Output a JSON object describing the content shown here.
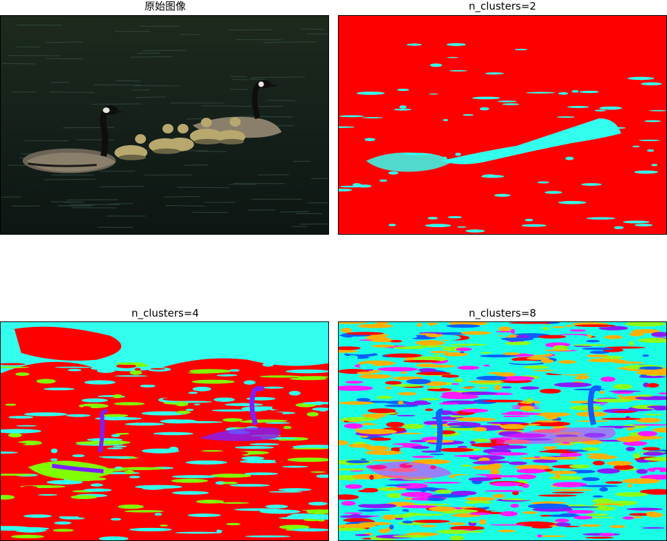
{
  "figure": {
    "panels": [
      {
        "id": "original",
        "title": "原始图像"
      },
      {
        "id": "k2",
        "title": "n_clusters=2"
      },
      {
        "id": "k4",
        "title": "n_clusters=4"
      },
      {
        "id": "k8",
        "title": "n_clusters=8"
      }
    ]
  },
  "colors": {
    "water_dark": "#1c2418",
    "k2_red": "#ff0000",
    "k2_cyan": "#33ffee",
    "k4_red": "#ff0000",
    "k4_cyan": "#33ffee",
    "k4_green": "#80ff00",
    "k4_violet": "#7f1fff",
    "k8_cyan": "#19ffe6",
    "k8_orange": "#ffb000",
    "k8_blue": "#0a5fff",
    "k8_violet": "#8a1aff",
    "k8_red": "#ff0000",
    "k8_green": "#8cff1a",
    "k8_magenta": "#ff1aff"
  }
}
